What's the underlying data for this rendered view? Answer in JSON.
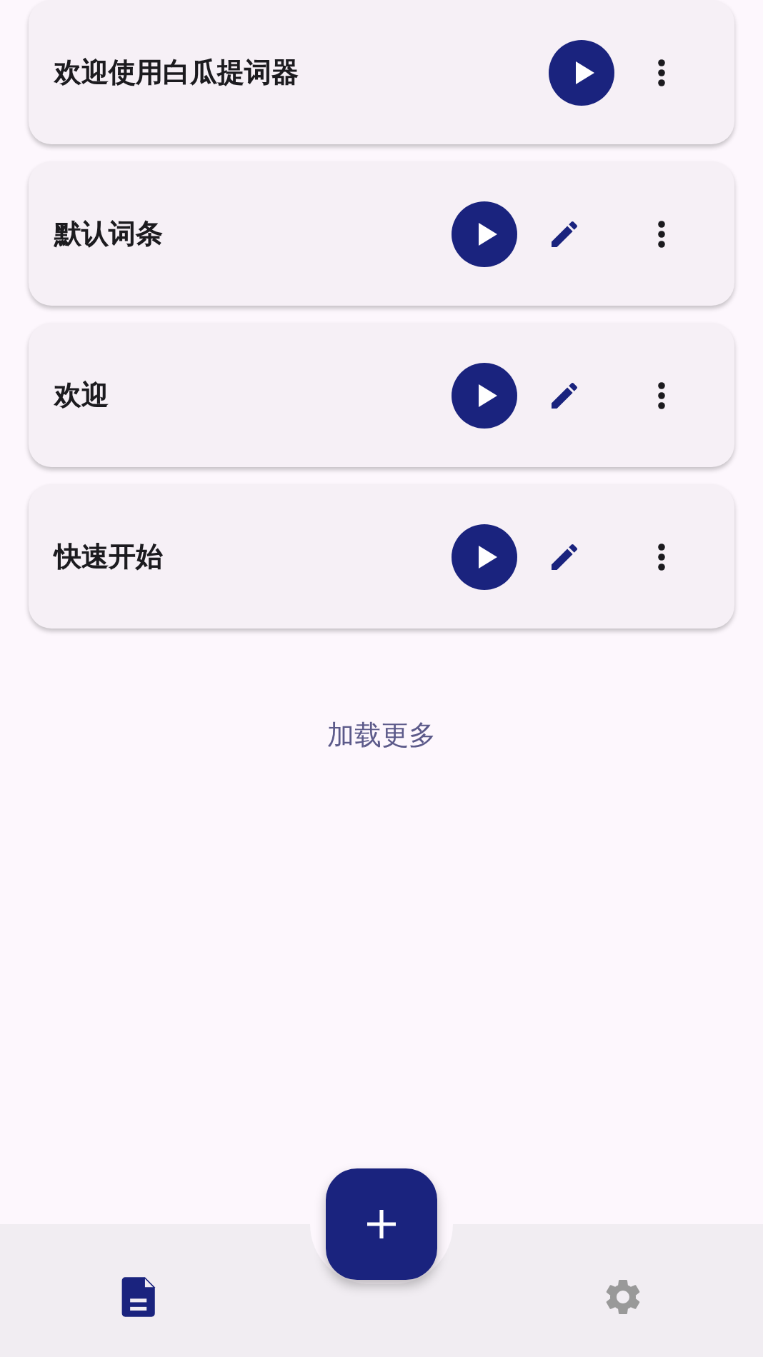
{
  "items": [
    {
      "title": "欢迎使用白瓜提词器",
      "editable": false
    },
    {
      "title": "默认词条",
      "editable": true
    },
    {
      "title": "欢迎",
      "editable": true
    },
    {
      "title": "快速开始",
      "editable": true
    }
  ],
  "load_more": "加载更多",
  "nav_tabs": [
    {
      "kind": "documents",
      "selected": true
    },
    {
      "kind": "settings",
      "selected": false
    }
  ]
}
